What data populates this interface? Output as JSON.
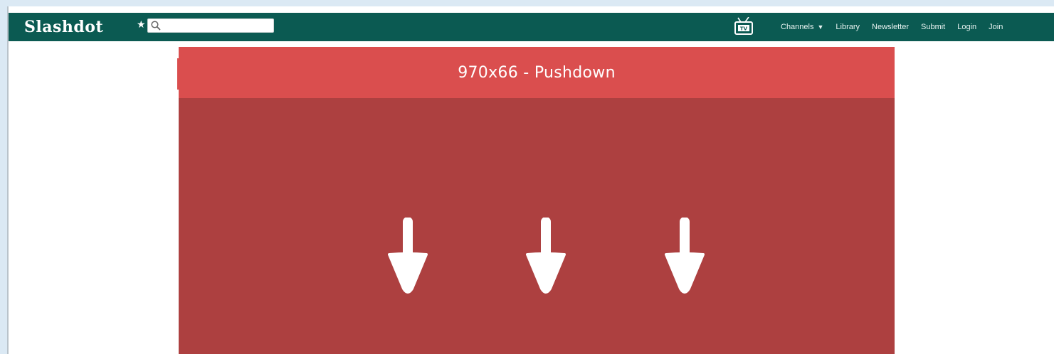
{
  "navbar": {
    "logo_text": "Slashdot",
    "search": {
      "value": "",
      "placeholder": ""
    },
    "links": [
      {
        "label": "Channels",
        "has_dropdown": true
      },
      {
        "label": "Library"
      },
      {
        "label": "Newsletter"
      },
      {
        "label": "Submit"
      },
      {
        "label": "Login"
      },
      {
        "label": "Join"
      }
    ],
    "icons": [
      "star-icon",
      "search-icon",
      "tv-icon"
    ],
    "background_color": "#0b5a52"
  },
  "ad": {
    "header_text": "970x66 - Pushdown",
    "header_color": "#da4e4e",
    "body_color": "#ad4040",
    "arrow_icons": [
      "down-arrow-icon",
      "down-arrow-icon",
      "down-arrow-icon"
    ]
  },
  "page": {
    "background_color": "#dbe9f4"
  }
}
